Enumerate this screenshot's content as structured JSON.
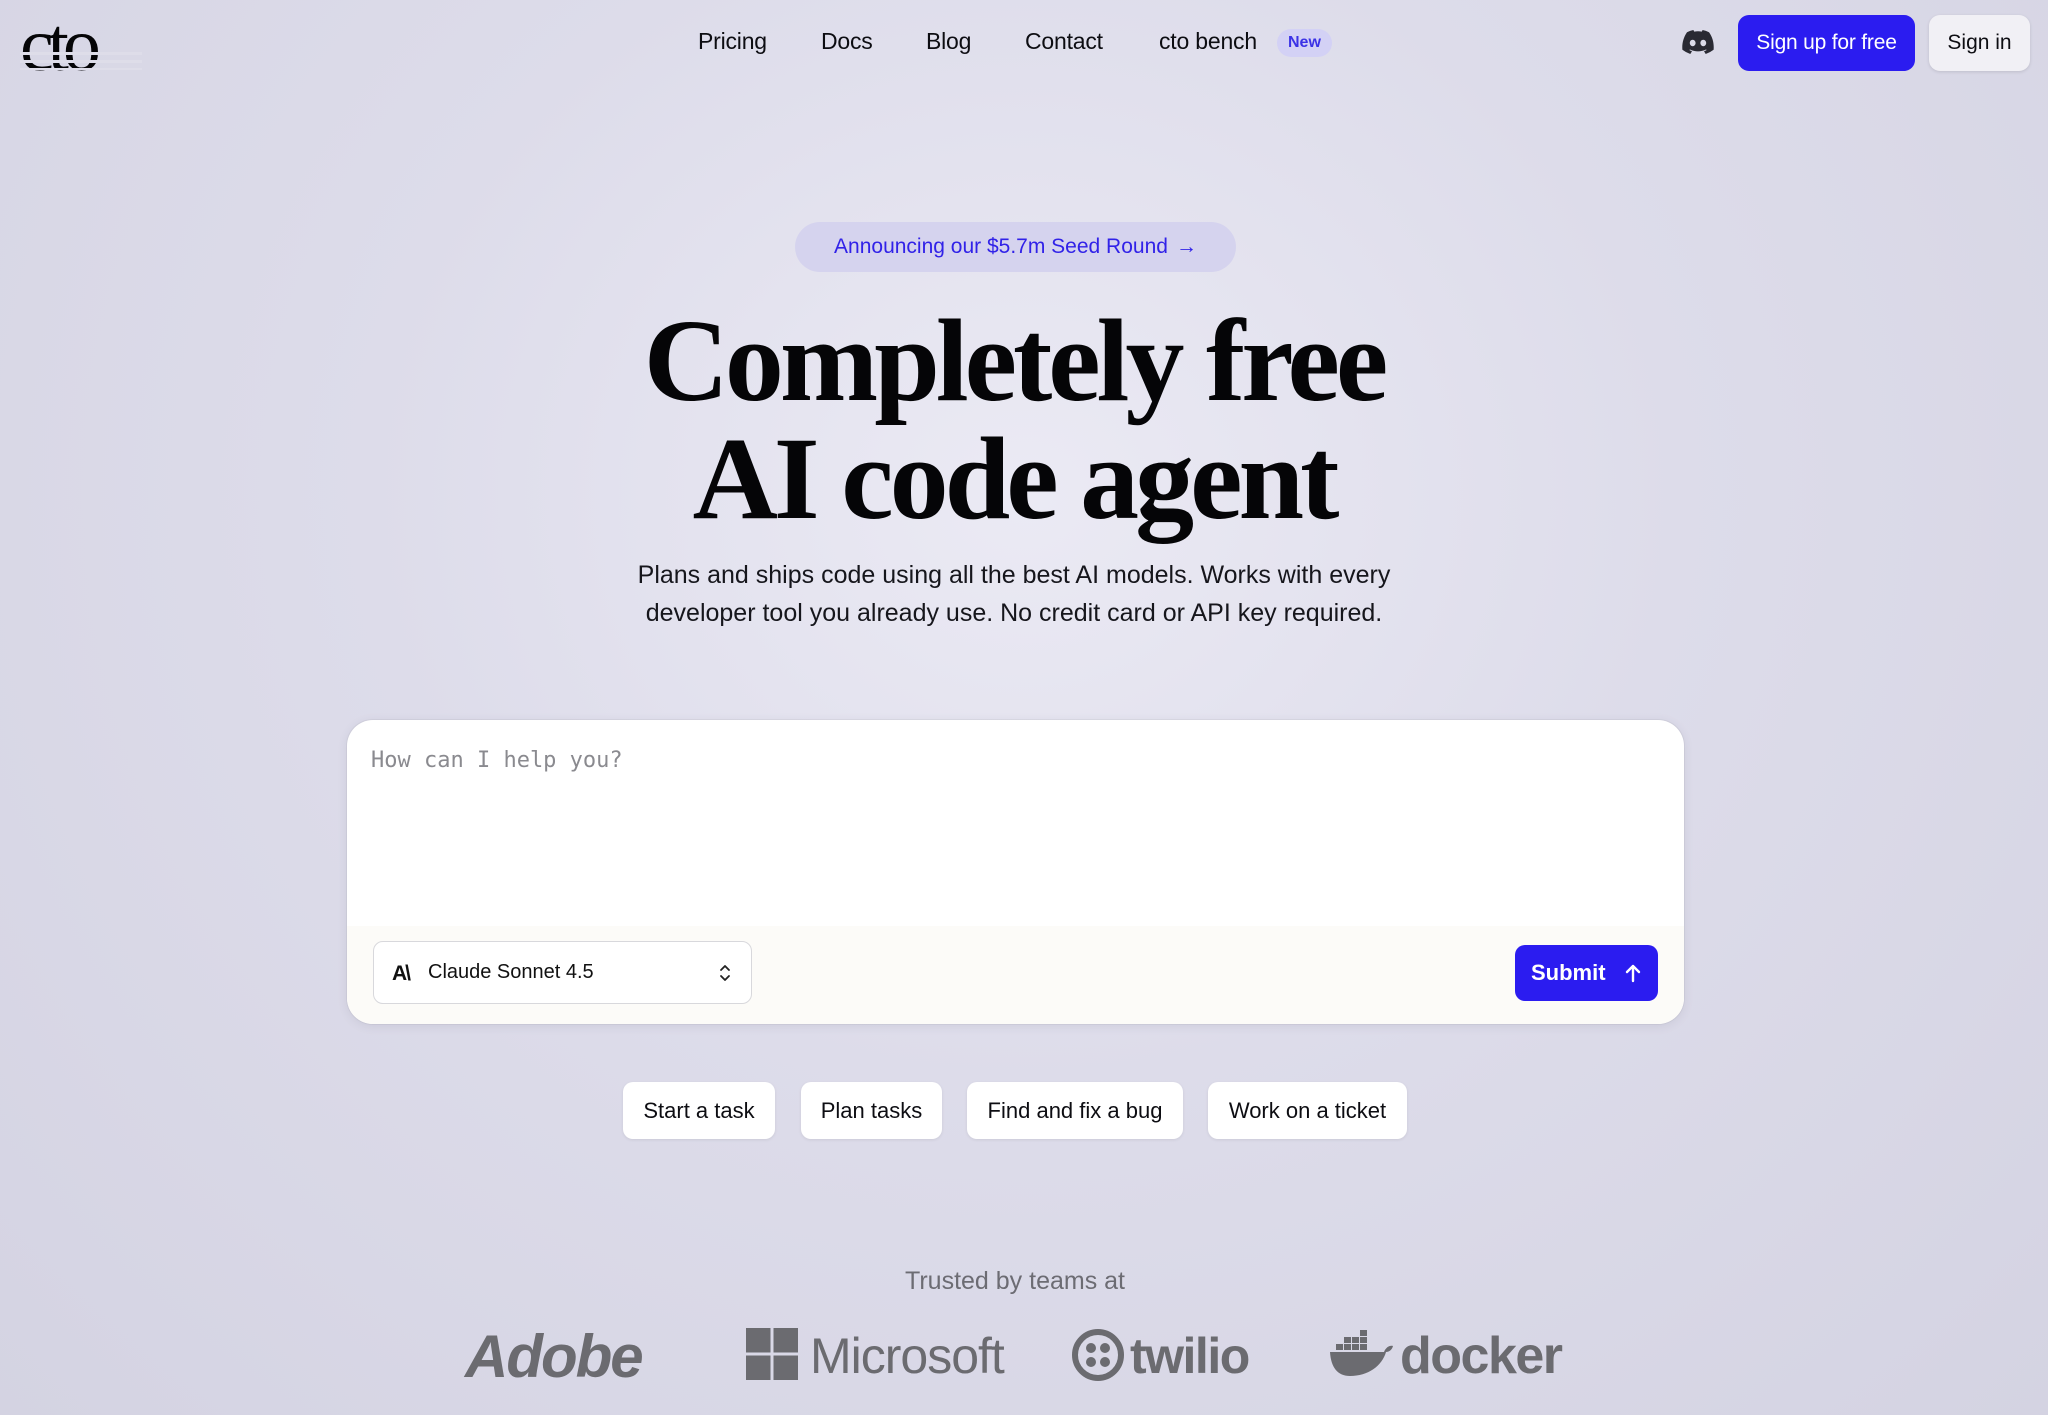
{
  "header": {
    "logo_text": "cto",
    "nav": {
      "pricing": "Pricing",
      "docs": "Docs",
      "blog": "Blog",
      "contact": "Contact",
      "bench": "cto bench",
      "bench_badge": "New"
    },
    "discord_icon": "discord-icon",
    "signup_label": "Sign up for free",
    "signin_label": "Sign in"
  },
  "hero": {
    "announcement": "Announcing our $5.7m Seed Round",
    "announcement_arrow": "→",
    "title_line1": "Completely free",
    "title_line2": "AI code agent",
    "subtitle_line1": "Plans and ships code using all the best AI models. Works with every",
    "subtitle_line2": "developer tool you already use. No credit card or API key required."
  },
  "prompt": {
    "placeholder": "How can I help you?",
    "value": "",
    "model_logo": "A\\",
    "model_selected": "Claude Sonnet 4.5",
    "submit_label": "Submit"
  },
  "suggestions": [
    "Start a task",
    "Plan tasks",
    "Find and fix a bug",
    "Work on a ticket"
  ],
  "trusted": {
    "label": "Trusted by teams at",
    "logos": [
      "Adobe",
      "Microsoft",
      "twilio",
      "docker"
    ]
  },
  "colors": {
    "accent": "#2b1cf0",
    "announce_bg": "#d5d3ee",
    "badge_bg": "#d3d1f5",
    "logo_gray": "#6b6b70"
  }
}
